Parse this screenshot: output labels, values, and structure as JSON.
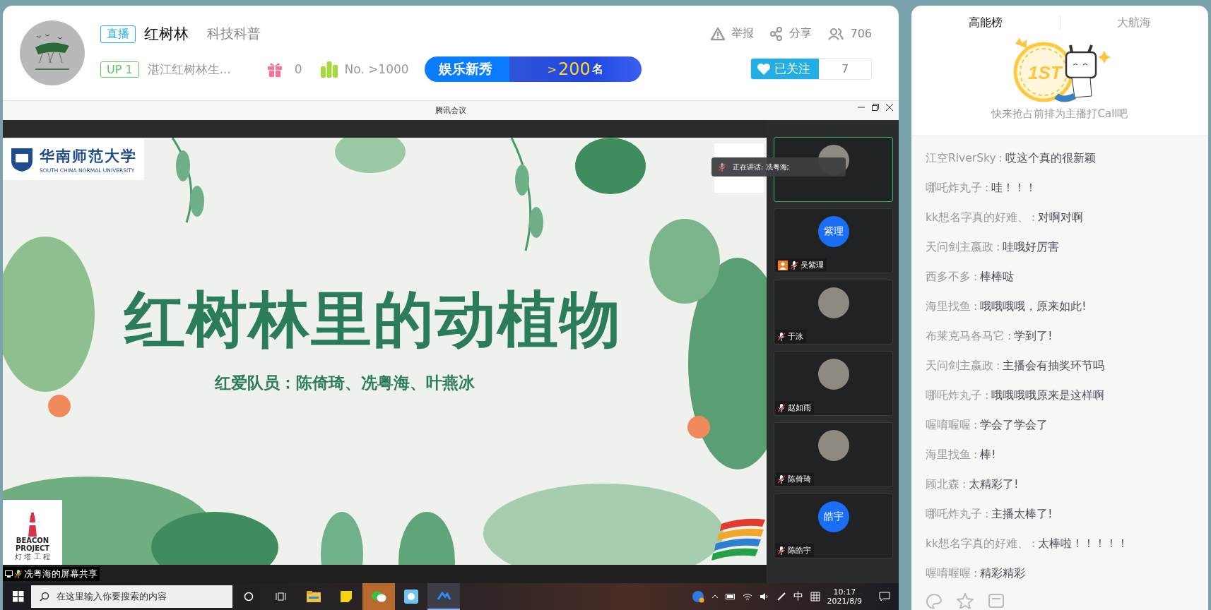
{
  "room": {
    "live_badge": "直播",
    "title": "红树林",
    "category": "科技科普",
    "up_badge": "UP 1",
    "streamer_name": "湛江红树林生...",
    "gift_count": "0",
    "rank": "No. >1000",
    "promo": {
      "label": "娱乐新秀",
      "rank_prefix": ">",
      "rank_number": "200",
      "rank_unit": "名"
    },
    "actions": [
      {
        "kind": "report",
        "label": "举报"
      },
      {
        "kind": "share",
        "label": "分享"
      },
      {
        "kind": "viewers",
        "label": "706"
      }
    ],
    "follow": {
      "label": "已关注",
      "count": "7",
      "followed": true
    }
  },
  "meeting": {
    "title": "腾讯会议",
    "slide": {
      "university": "华南师范大学",
      "university_en": "SOUTH CHINA NORMAL UNIVERSITY",
      "title": "红树林里的动植物",
      "subtitle": "红爱队员：陈倚琦、冼粤海、叶燕冰",
      "badge_lines": [
        "BEACON",
        "PROJECT"
      ],
      "badge_sub": "灯 塔 工 程"
    },
    "speaking_toast": "正在讲话: 冼粤海;",
    "participants": [
      {
        "kind": "photo",
        "selected": true
      },
      {
        "kind": "initials",
        "initials": "紫理",
        "name": "吴紫理",
        "host": true,
        "selected": false
      },
      {
        "kind": "photo",
        "name": "于泳",
        "host": false,
        "selected": false
      },
      {
        "kind": "photo",
        "name": "赵如雨",
        "host": false,
        "selected": false
      },
      {
        "kind": "photo",
        "name": "陈倚琦",
        "host": false,
        "selected": false
      },
      {
        "kind": "initials",
        "initials": "皓宇",
        "name": "陈皓宇",
        "host": false,
        "selected": false
      }
    ],
    "share_label": "冼粤海的屏幕共享"
  },
  "taskbar": {
    "search_placeholder": "在这里输入你要搜索的内容",
    "ime": "中",
    "time": "10:17",
    "date": "2021/8/9"
  },
  "side": {
    "tabs": [
      {
        "label": "高能榜",
        "selected": true
      },
      {
        "label": "大航海",
        "selected": false
      }
    ],
    "rank_badge": "1ST",
    "empty_hint": "快来抢占前排为主播打Call吧",
    "danmaku": [
      {
        "user": "江空RiverSky",
        "separator": ":",
        "text": "哎这个真的很新颖"
      },
      {
        "user": "哪吒炸丸子",
        "separator": ":",
        "text": "哇！！！"
      },
      {
        "user": "kk想名字真的好难、",
        "separator": ":",
        "text": "对啊对啊"
      },
      {
        "user": "天问剑主嬴政",
        "separator": ":",
        "text": "哇哦好厉害"
      },
      {
        "user": "西多不多",
        "separator": ":",
        "text": "棒棒哒"
      },
      {
        "user": "海里找鱼",
        "separator": ":",
        "text": "哦哦哦哦，原来如此!"
      },
      {
        "user": "布莱克马各马它",
        "separator": ":",
        "text": "学到了!"
      },
      {
        "user": "天问剑主嬴政",
        "separator": ":",
        "text": "主播会有抽奖环节吗"
      },
      {
        "user": "哪吒炸丸子",
        "separator": ":",
        "text": "哦哦哦哦原来是这样啊"
      },
      {
        "user": "喔唷喔喔",
        "separator": ":",
        "text": "学会了学会了"
      },
      {
        "user": "海里找鱼",
        "separator": ":",
        "text": "棒!"
      },
      {
        "user": "顾北森",
        "separator": ":",
        "text": "太精彩了!"
      },
      {
        "user": "哪吒炸丸子",
        "separator": ":",
        "text": "主播太棒了!"
      },
      {
        "user": "kk想名字真的好难、",
        "separator": ":",
        "text": "太棒啦！！！！！"
      },
      {
        "user": "喔唷喔喔",
        "separator": ":",
        "text": "精彩精彩"
      }
    ]
  }
}
